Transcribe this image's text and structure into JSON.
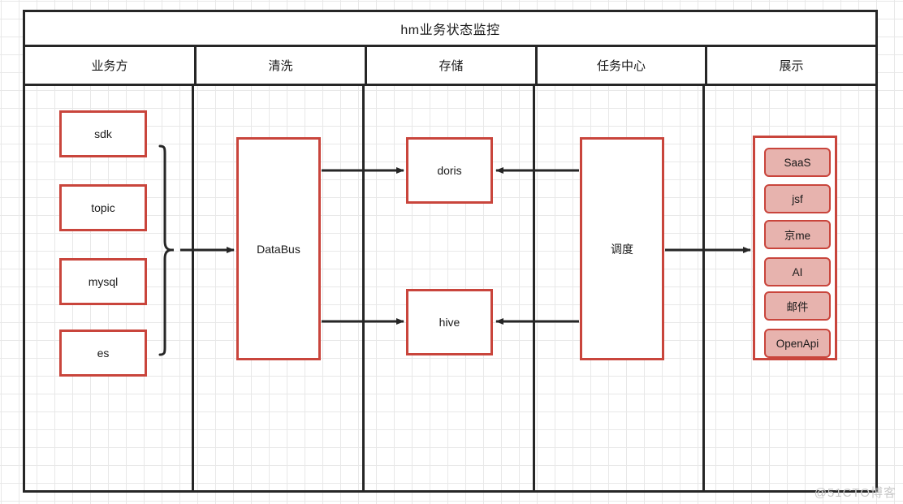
{
  "diagram": {
    "title": "hm业务状态监控",
    "watermark": "@51CTO博客",
    "columns": [
      {
        "id": "business",
        "label": "业务方"
      },
      {
        "id": "clean",
        "label": "清洗"
      },
      {
        "id": "storage",
        "label": "存储"
      },
      {
        "id": "task-center",
        "label": "任务中心"
      },
      {
        "id": "display",
        "label": "展示"
      }
    ],
    "sources": [
      {
        "id": "sdk",
        "label": "sdk"
      },
      {
        "id": "topic",
        "label": "topic"
      },
      {
        "id": "mysql",
        "label": "mysql"
      },
      {
        "id": "es",
        "label": "es"
      }
    ],
    "clean": {
      "id": "databus",
      "label": "DataBus"
    },
    "storage": [
      {
        "id": "doris",
        "label": "doris"
      },
      {
        "id": "hive",
        "label": "hive"
      }
    ],
    "task_center": {
      "id": "schedule",
      "label": "调度"
    },
    "display_channels": [
      {
        "id": "saas",
        "label": "SaaS"
      },
      {
        "id": "jsf",
        "label": "jsf"
      },
      {
        "id": "jingme",
        "label": "京me"
      },
      {
        "id": "ai",
        "label": "AI"
      },
      {
        "id": "email",
        "label": "邮件"
      },
      {
        "id": "openapi",
        "label": "OpenApi"
      }
    ],
    "colors": {
      "node_border": "#c9453c",
      "chip_fill": "#e7b3ae",
      "frame": "#262626",
      "grid": "#e8e8e8",
      "arrow": "#262626",
      "watermark": "#c9c9c9"
    }
  }
}
